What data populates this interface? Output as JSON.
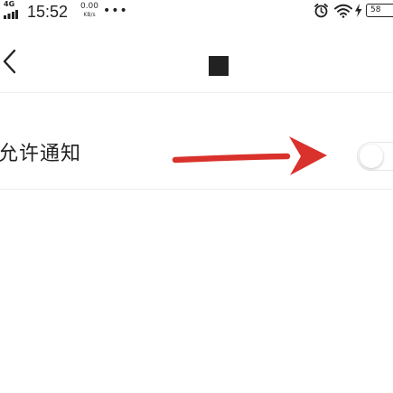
{
  "status_bar": {
    "network_label": "4G",
    "time": "15:52",
    "speed_value": "0.00",
    "speed_unit": "KB/s",
    "more_indicator": "•••",
    "battery_level": "58",
    "icons": [
      "signal-bars-icon",
      "alarm-icon",
      "wifi-icon",
      "charging-bolt-icon",
      "battery-icon"
    ]
  },
  "nav": {
    "back_icon": "chevron-left-icon"
  },
  "settings": {
    "allow_notifications_label": "允许通知",
    "allow_notifications_enabled": false
  },
  "colors": {
    "background": "#ffffff",
    "text": "#222222",
    "divider": "#eeeeee",
    "annotation_arrow": "#d9312b",
    "toggle_off_track": "#ffffff"
  }
}
